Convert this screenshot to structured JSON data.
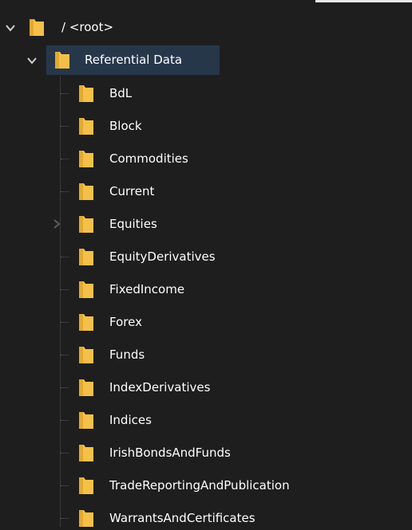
{
  "root": {
    "label": "/ <root>"
  },
  "referential": {
    "label": "Referential Data"
  },
  "children": [
    {
      "label": "BdL"
    },
    {
      "label": "Block"
    },
    {
      "label": "Commodities"
    },
    {
      "label": "Current"
    },
    {
      "label": "Equities"
    },
    {
      "label": "EquityDerivatives"
    },
    {
      "label": "FixedIncome"
    },
    {
      "label": "Forex"
    },
    {
      "label": "Funds"
    },
    {
      "label": "IndexDerivatives"
    },
    {
      "label": "Indices"
    },
    {
      "label": "IrishBondsAndFunds"
    },
    {
      "label": "TradeReportingAndPublication"
    },
    {
      "label": "WarrantsAndCertificates"
    }
  ],
  "colors": {
    "background": "#1e1e1e",
    "selection": "#26374a",
    "folder": "#f5c04a",
    "text": "#ffffff"
  }
}
